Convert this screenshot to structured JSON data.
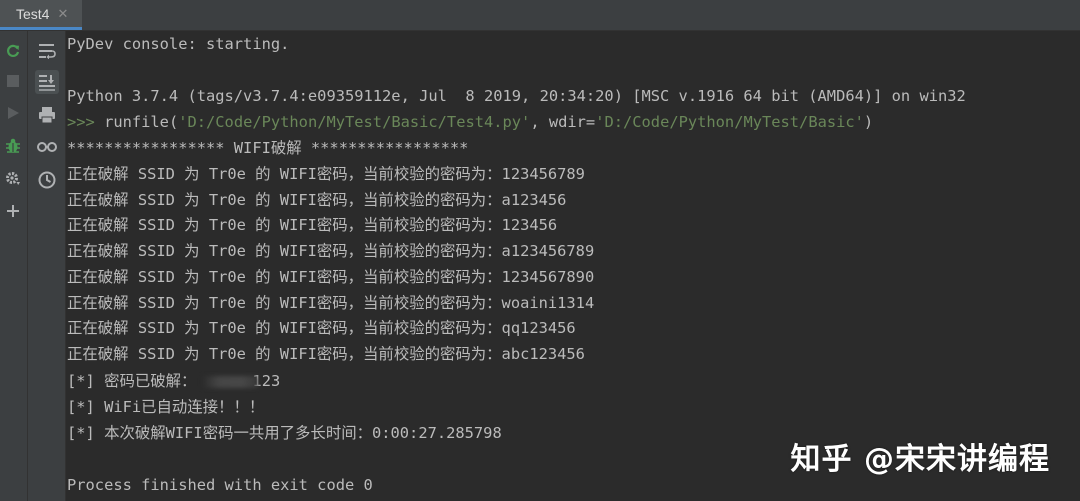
{
  "tab": {
    "title": "Test4",
    "close": "✕"
  },
  "left_toolbar": {
    "buttons": [
      "rerun-icon",
      "stop-icon",
      "run-icon",
      "debug-icon",
      "settings-icon",
      "add-icon"
    ]
  },
  "side_toolbar": {
    "buttons": [
      "soft-wrap-icon",
      "scroll-to-end-icon",
      "print-icon",
      "variables-icon",
      "history-icon"
    ]
  },
  "console": {
    "starting": "PyDev console: starting.",
    "version": "Python 3.7.4 (tags/v3.7.4:e09359112e, Jul  8 2019, 20:34:20) [MSC v.1916 64 bit (AMD64)] on win32",
    "command": {
      "prompt": ">>> ",
      "pre": "runfile(",
      "path": "'D:/Code/Python/MyTest/Basic/Test4.py'",
      "mid": ", wdir=",
      "wdir": "'D:/Code/Python/MyTest/Basic'",
      "post": ")"
    },
    "header": "***************** WIFI破解 *****************",
    "attempts": [
      "正在破解 SSID 为 Tr0e 的 WIFI密码，当前校验的密码为：123456789",
      "正在破解 SSID 为 Tr0e 的 WIFI密码，当前校验的密码为：a123456",
      "正在破解 SSID 为 Tr0e 的 WIFI密码，当前校验的密码为：123456",
      "正在破解 SSID 为 Tr0e 的 WIFI密码，当前校验的密码为：a123456789",
      "正在破解 SSID 为 Tr0e 的 WIFI密码，当前校验的密码为：1234567890",
      "正在破解 SSID 为 Tr0e 的 WIFI密码，当前校验的密码为：woaini1314",
      "正在破解 SSID 为 Tr0e 的 WIFI密码，当前校验的密码为：qq123456",
      "正在破解 SSID 为 Tr0e 的 WIFI密码，当前校验的密码为：abc123456"
    ],
    "cracked_prefix": "[*] 密码已破解：",
    "cracked_suffix": "123",
    "connected": "[*] WiFi已自动连接！！！",
    "elapsed": "[*] 本次破解WIFI密码一共用了多长时间：0:00:27.285798",
    "finished": "Process finished with exit code 0"
  },
  "watermark": "知乎 @宋宋讲编程",
  "colors": {
    "background": "#2b2b2b",
    "text": "#bbbbbb",
    "string": "#6a8759",
    "rerun_green": "#499c54",
    "tab_underline": "#4a88c7"
  }
}
